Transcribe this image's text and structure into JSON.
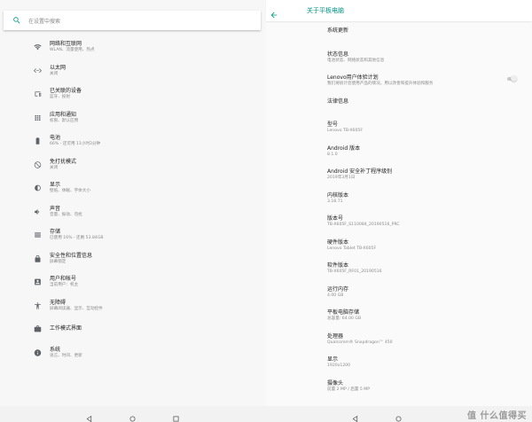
{
  "search": {
    "placeholder": "在设置中搜索"
  },
  "settings_menu": [
    {
      "icon": "wifi-icon",
      "title": "网络和互联网",
      "sub": "WLAN、流量使用、热点"
    },
    {
      "icon": "ethernet-icon",
      "title": "以太网",
      "sub": "关闭"
    },
    {
      "icon": "devices-icon",
      "title": "已关联的设备",
      "sub": "蓝牙、投射"
    },
    {
      "icon": "apps-icon",
      "title": "应用和通知",
      "sub": "权限、默认应用"
    },
    {
      "icon": "battery-icon",
      "title": "电池",
      "sub": "66% - 还可用 11小时2分钟"
    },
    {
      "icon": "do-not-disturb-icon",
      "title": "免打扰模式",
      "sub": "关闭"
    },
    {
      "icon": "brightness-icon",
      "title": "显示",
      "sub": "壁纸、休眠、字体大小"
    },
    {
      "icon": "volume-icon",
      "title": "声音",
      "sub": "音量、振动、勿扰"
    },
    {
      "icon": "storage-icon",
      "title": "存储",
      "sub": "已使用 16% - 还剩 53.84GB"
    },
    {
      "icon": "lock-icon",
      "title": "安全性和位置信息",
      "sub": "屏幕锁定"
    },
    {
      "icon": "account-icon",
      "title": "用户和帐号",
      "sub": "当前用户：机主"
    },
    {
      "icon": "accessibility-icon",
      "title": "无障碍",
      "sub": "屏幕阅读器、显示、互动控件"
    },
    {
      "icon": "briefcase-icon",
      "title": "工作模式界面",
      "sub": ""
    },
    {
      "icon": "info-icon",
      "title": "系统",
      "sub": "语言、时间、更新"
    }
  ],
  "about": {
    "title": "关于平板电脑",
    "rows": [
      {
        "h": "系统更新",
        "v": ""
      },
      {
        "h": "状态信息",
        "v": "电池状态、网络状态和其他信息"
      },
      {
        "h": "Lenovo用户体验计划",
        "v": "我们将统计您使用产品的情况，用以改善和提升体验和服务",
        "toggle": true
      },
      {
        "h": "法律信息",
        "v": ""
      },
      {
        "h": "型号",
        "v": "Lenovo TB-X605F"
      },
      {
        "h": "Android 版本",
        "v": "8.1.0"
      },
      {
        "h": "Android 安全补丁程序级别",
        "v": "2019年3月1日"
      },
      {
        "h": "内核版本",
        "v": "3.18.71"
      },
      {
        "h": "版本号",
        "v": "TB-X605F_S110084_20190516_PRC"
      },
      {
        "h": "硬件版本",
        "v": "Lenovo Tablet TB-X605F"
      },
      {
        "h": "软件版本",
        "v": "TB-X605F_RF01_20190516"
      },
      {
        "h": "运行内存",
        "v": "4.00 GB"
      },
      {
        "h": "平板电脑存储",
        "v": "总容量: 64.00 GB"
      },
      {
        "h": "处理器",
        "v": "Qualcomm® Snapdragon™ 450"
      },
      {
        "h": "显示",
        "v": "1920x1200"
      },
      {
        "h": "摄像头",
        "v": "前置 2 MP / 后置 5 MP"
      }
    ]
  },
  "watermark": "值 什么值得买",
  "colors": {
    "accent": "#009688",
    "icon": "#5f6368"
  }
}
